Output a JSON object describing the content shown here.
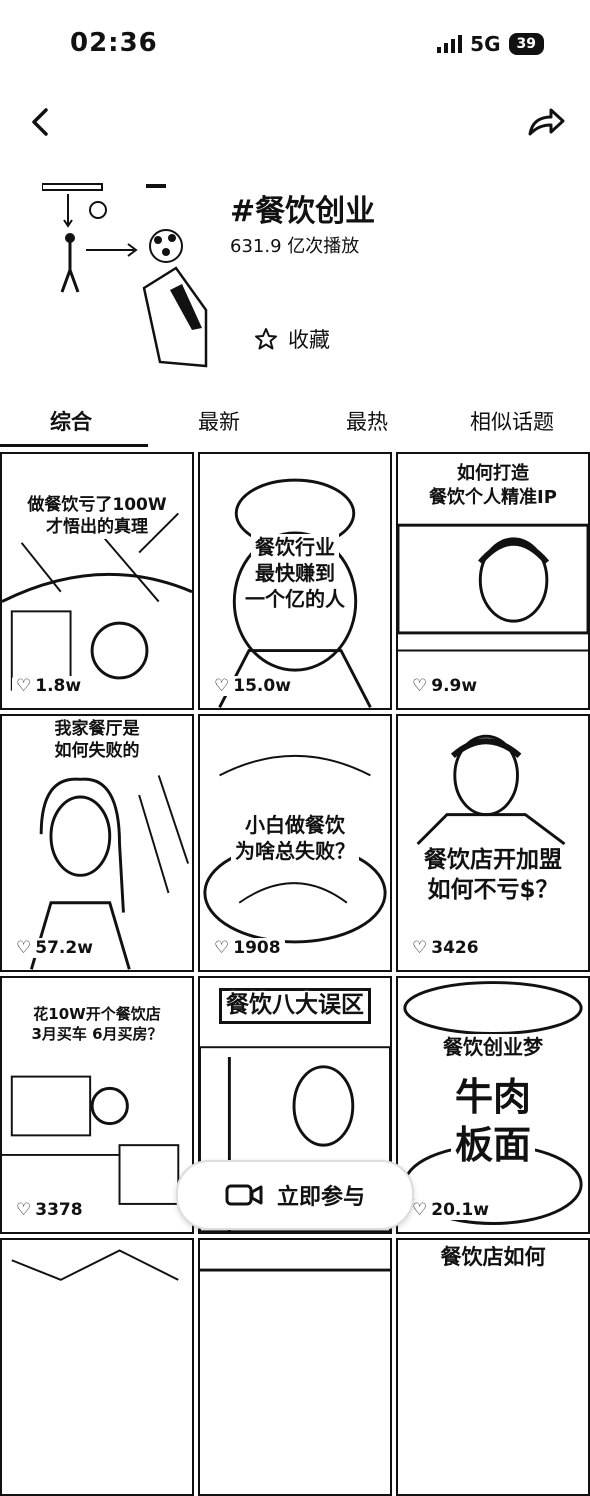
{
  "status_bar": {
    "time": "02:36",
    "signal": "5G",
    "battery": "39"
  },
  "topic": {
    "title": "#餐饮创业",
    "plays": "631.9 亿次播放",
    "favorite_label": "收藏"
  },
  "tabs": [
    {
      "label": "综合",
      "active": true
    },
    {
      "label": "最新",
      "active": false
    },
    {
      "label": "最热",
      "active": false
    },
    {
      "label": "相似话题",
      "active": false
    }
  ],
  "videos": [
    {
      "caption_lines": [
        "做餐饮亏了100W",
        "才悟出的真理"
      ],
      "likes": "1.8w"
    },
    {
      "caption_lines": [
        "餐饮行业",
        "最快赚到",
        "一个亿的人"
      ],
      "likes": "15.0w"
    },
    {
      "caption_lines": [
        "如何打造",
        "餐饮个人精准IP"
      ],
      "likes": "9.9w"
    },
    {
      "caption_lines": [
        "我家餐厅是",
        "如何失败的"
      ],
      "likes": "57.2w"
    },
    {
      "caption_lines": [
        "小白做餐饮",
        "为啥总失败？"
      ],
      "likes": "1908"
    },
    {
      "caption_lines": [
        "餐饮店开加盟",
        "如何不亏$？"
      ],
      "likes": "3426"
    },
    {
      "caption_lines": [
        "花10W开个餐饮店",
        "3月买车 6月买房？"
      ],
      "likes": "3378"
    },
    {
      "caption_lines": [
        "餐饮八大误区"
      ],
      "likes": ""
    },
    {
      "caption_lines": [
        "餐饮创业梦",
        "牛肉",
        "板面"
      ],
      "likes": "20.1w"
    },
    {
      "caption_lines": [
        ""
      ],
      "likes": ""
    },
    {
      "caption_lines": [
        ""
      ],
      "likes": ""
    },
    {
      "caption_lines": [
        "餐饮店如何"
      ],
      "likes": ""
    }
  ],
  "join_button": {
    "label": "立即参与"
  },
  "icons": {
    "back": "back-arrow-icon",
    "share": "share-icon",
    "star": "star-icon",
    "heart": "heart-icon",
    "camera": "video-camera-icon"
  }
}
